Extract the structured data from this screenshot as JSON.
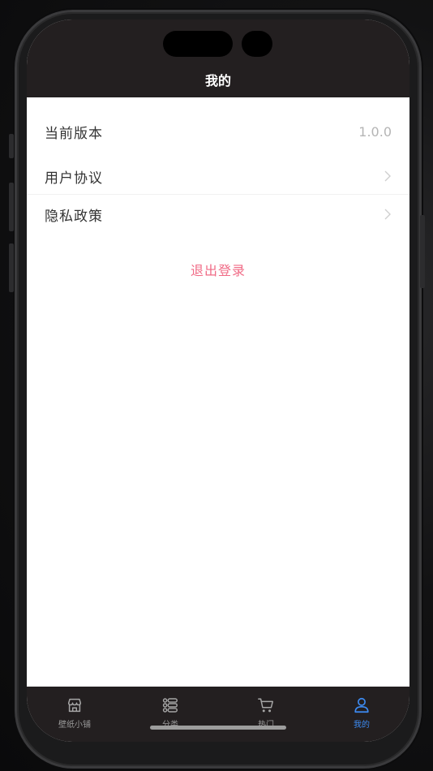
{
  "header": {
    "title": "我的"
  },
  "settings": {
    "version_label": "当前版本",
    "version_value": "1.0.0",
    "agreement_label": "用户协议",
    "privacy_label": "隐私政策",
    "logout_label": "退出登录"
  },
  "tabbar": {
    "items": [
      {
        "label": "壁纸小铺",
        "icon": "store-icon",
        "active": false
      },
      {
        "label": "分类",
        "icon": "list-icon",
        "active": false
      },
      {
        "label": "热门",
        "icon": "cart-icon",
        "active": false
      },
      {
        "label": "我的",
        "icon": "user-icon",
        "active": true
      }
    ]
  },
  "colors": {
    "bar_background": "#231f20",
    "accent": "#3d8bf2",
    "logout": "#f06b86"
  }
}
